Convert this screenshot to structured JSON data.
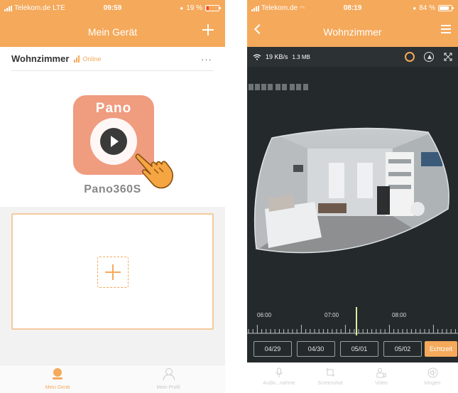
{
  "left_phone": {
    "statusbar": {
      "carrier": "Telekom.de",
      "network": "LTE",
      "time": "09:59",
      "battery": "19 %",
      "battery_level": 0.19
    },
    "nav": {
      "title": "Mein Gerät",
      "add_icon": "plus-icon"
    },
    "device": {
      "name": "Wohnzimmer",
      "status": "Online",
      "more_icon": "more-dots-icon",
      "logo_text": "Pano",
      "model": "Pano360S",
      "play_icon": "play-icon",
      "hand_icon": "tap-hand-icon"
    },
    "add_device": {
      "icon": "plus-icon"
    },
    "tabbar": [
      {
        "label": "Mein Gerät",
        "icon": "camera-device-icon",
        "active": true
      },
      {
        "label": "Mein Profil",
        "icon": "person-icon",
        "active": false
      }
    ]
  },
  "right_phone": {
    "statusbar": {
      "carrier": "Telekom.de",
      "time": "08:19",
      "battery": "84 %",
      "battery_level": 0.84
    },
    "nav": {
      "title": "Wohnzimmer",
      "back_icon": "back-chevron-icon",
      "menu_icon": "menu-icon"
    },
    "live": {
      "speed": "19 KB/s",
      "data_total": "1.3 MB",
      "toolbar_icons": [
        "wifi-icon",
        "capture-icon",
        "view-mode-icon",
        "fullscreen-icon"
      ]
    },
    "timeline": {
      "labels": [
        "06:00",
        "07:00",
        "08:00"
      ]
    },
    "dates": [
      "04/29",
      "04/30",
      "05/01",
      "05/02"
    ],
    "live_button": "Echtzeit",
    "tabbar": [
      {
        "label": "Audio...nahme",
        "icon": "microphone-icon"
      },
      {
        "label": "Screenshot",
        "icon": "crop-icon"
      },
      {
        "label": "Video",
        "icon": "video-icon"
      },
      {
        "label": "klingen",
        "icon": "speaker-icon"
      }
    ]
  },
  "colors": {
    "accent": "#f5a95b",
    "live_bg": "#24292b",
    "tile": "#ef9c7f"
  }
}
